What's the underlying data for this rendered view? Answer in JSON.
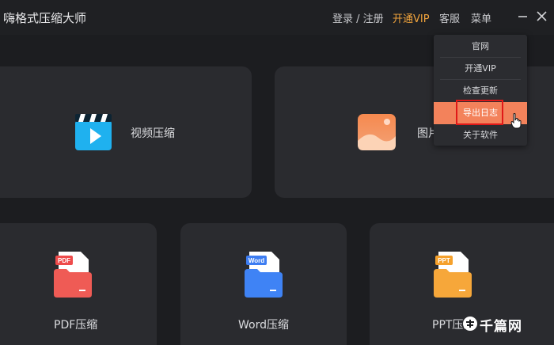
{
  "app": {
    "title": "嗨格式压缩大师"
  },
  "header": {
    "login": "登录 / 注册",
    "vip": "开通VIP",
    "service": "客服",
    "menu": "菜单"
  },
  "cards": {
    "video": "视频压缩",
    "image": "图片压缩",
    "pdf": "PDF压缩",
    "word": "Word压缩",
    "ppt": "PPT压缩"
  },
  "icons": {
    "pdf_tag": "PDF",
    "word_tag": "Word",
    "ppt_tag": "PPT"
  },
  "dropdown": {
    "items": [
      "官网",
      "开通VIP",
      "检查更新",
      "导出日志",
      "关于软件"
    ],
    "active_index": 3
  },
  "watermark": {
    "text": "千篇网"
  },
  "colors": {
    "accent": "#f3825b",
    "vip": "#f2a43c",
    "highlight": "#e01818",
    "card": "#2a2b2f",
    "background": "#1c1d20"
  }
}
